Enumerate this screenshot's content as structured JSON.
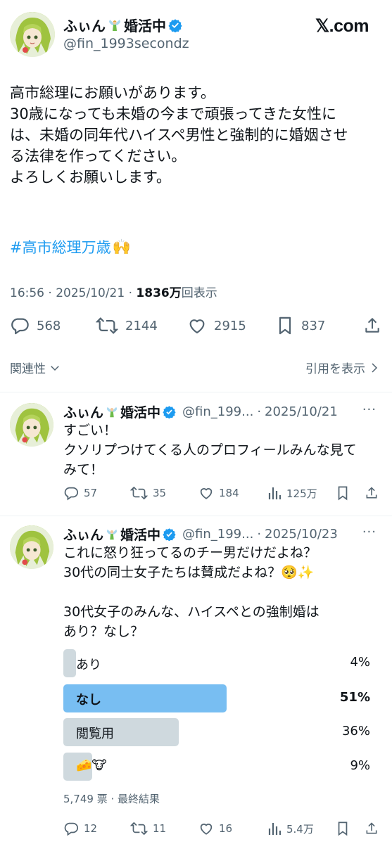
{
  "brand": "𝕏.com",
  "main_tweet": {
    "author": {
      "name": "ふぃん🧚婚活中",
      "name_text": "ふぃん",
      "name_suffix": "婚活中",
      "handle": "@fin_1993secondz"
    },
    "lines": [
      "高市総理にお願いがあります。",
      "30歳になっても未婚の今まで頑張ってきた女性に",
      "は、未婚の同年代ハイスペ男性と強制的に婚姻させ",
      "る法律を作ってください。",
      "よろしくお願いします。"
    ],
    "hashtag": "#高市総理万歳",
    "hashtag_emoji": "🙌",
    "time": "16:56 · 2025/10/21 · ",
    "views_count": "1836万",
    "views_label": "回表示",
    "stats": {
      "replies": "568",
      "reposts": "2144",
      "likes": "2915",
      "bookmarks": "837"
    },
    "related_label": "関連性",
    "quotes_label": "引用を表示"
  },
  "replies": [
    {
      "name_text": "ふぃん",
      "name_suffix": "婚活中",
      "handle": "@fin_199...",
      "date": "2025/10/21",
      "lines": [
        "すごい！",
        "クソリプつけてくる人のプロフィールみんな見て",
        "みて！"
      ],
      "stats": {
        "replies": "57",
        "reposts": "35",
        "likes": "184",
        "views": "125万"
      }
    },
    {
      "name_text": "ふぃん",
      "name_suffix": "婚活中",
      "handle": "@fin_199...",
      "date": "2025/10/23",
      "lines": [
        "これに怒り狂ってるのチー男だけだよね？",
        "30代の同士女子たちは賛成だよね？🥺✨",
        "",
        "30代女子のみんな、ハイスペとの強制婚は",
        "あり？なし？"
      ],
      "poll": {
        "options": [
          {
            "label": "あり",
            "percent": "4%",
            "value": 4
          },
          {
            "label": "なし",
            "percent": "51%",
            "value": 51,
            "winner": true
          },
          {
            "label": "閲覧用",
            "percent": "36%",
            "value": 36
          },
          {
            "label": "🧀🐮",
            "percent": "9%",
            "value": 9
          }
        ],
        "footer": "5,749 票 · 最終結果"
      },
      "stats": {
        "replies": "12",
        "reposts": "11",
        "likes": "16",
        "views": "5.4万"
      }
    }
  ],
  "colors": {
    "accent": "#1d9bf0",
    "poll_winner": "#78bef2",
    "poll_other": "#cfd9de",
    "muted": "#536471"
  },
  "icons": [
    "reply-icon",
    "repost-icon",
    "like-icon",
    "bookmark-icon",
    "share-icon",
    "views-icon",
    "verified-icon",
    "fairy-icon",
    "chevron-down-icon",
    "chevron-right-icon",
    "more-icon"
  ]
}
